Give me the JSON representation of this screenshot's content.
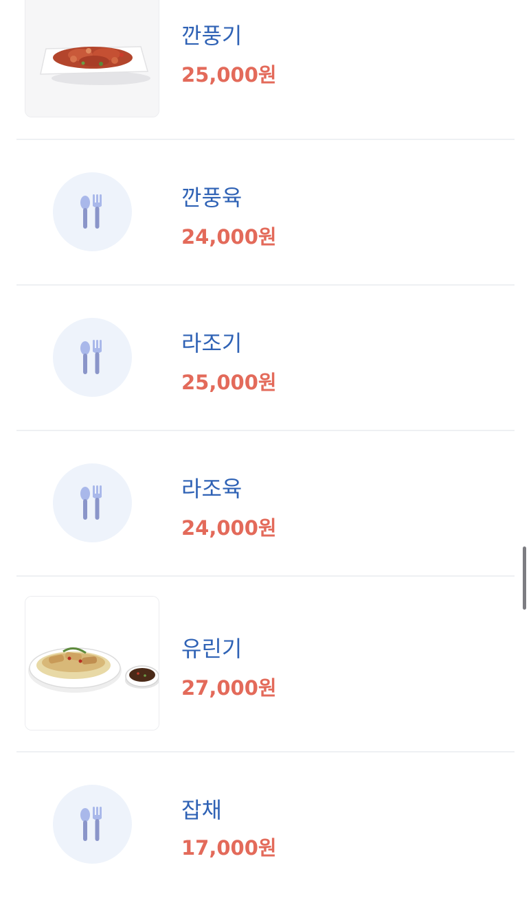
{
  "menu": {
    "items": [
      {
        "name": "깐풍기",
        "price": "25,000원",
        "image": "kkanpunggi-photo"
      },
      {
        "name": "깐풍육",
        "price": "24,000원",
        "image": "utensils-icon"
      },
      {
        "name": "라조기",
        "price": "25,000원",
        "image": "utensils-icon"
      },
      {
        "name": "라조육",
        "price": "24,000원",
        "image": "utensils-icon"
      },
      {
        "name": "유린기",
        "price": "27,000원",
        "image": "yuringi-photo"
      },
      {
        "name": "잡채",
        "price": "17,000원",
        "image": "utensils-icon"
      }
    ]
  },
  "colors": {
    "name": "#2f62b5",
    "price": "#e36a5a",
    "placeholder_bg": "#eef3fb",
    "icon": "#8a95c9"
  }
}
